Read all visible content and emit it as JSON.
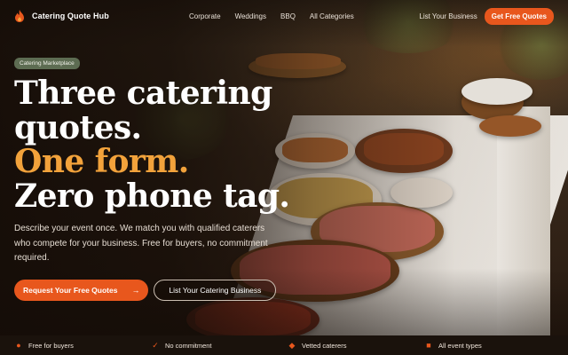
{
  "brand": {
    "name": "Catering Quote Hub",
    "icon": "flame-icon",
    "accent": "#e8571d"
  },
  "nav": {
    "links": [
      "Corporate",
      "Weddings",
      "BBQ",
      "All Categories"
    ],
    "list_business": "List Your Business",
    "cta": "Get Free Quotes"
  },
  "hero": {
    "badge": "Catering Marketplace",
    "headline": {
      "line1": "Three catering",
      "line2": "quotes.",
      "line3": "One form.",
      "line4": "Zero phone tag."
    },
    "highlight_color": "#f2a23b",
    "subtext": "Describe your event once. We match you with qualified caterers who compete for your business. Free for buyers, no commitment required.",
    "primary_cta": "Request Your Free Quotes",
    "primary_cta_icon": "arrow-right-icon",
    "secondary_cta": "List Your Catering Business"
  },
  "features": [
    {
      "label": "Free for buyers",
      "icon": "tag-icon"
    },
    {
      "label": "No commitment",
      "icon": "check-circle-icon"
    },
    {
      "label": "Vetted caterers",
      "icon": "shield-check-icon"
    },
    {
      "label": "All event types",
      "icon": "calendar-icon"
    }
  ]
}
